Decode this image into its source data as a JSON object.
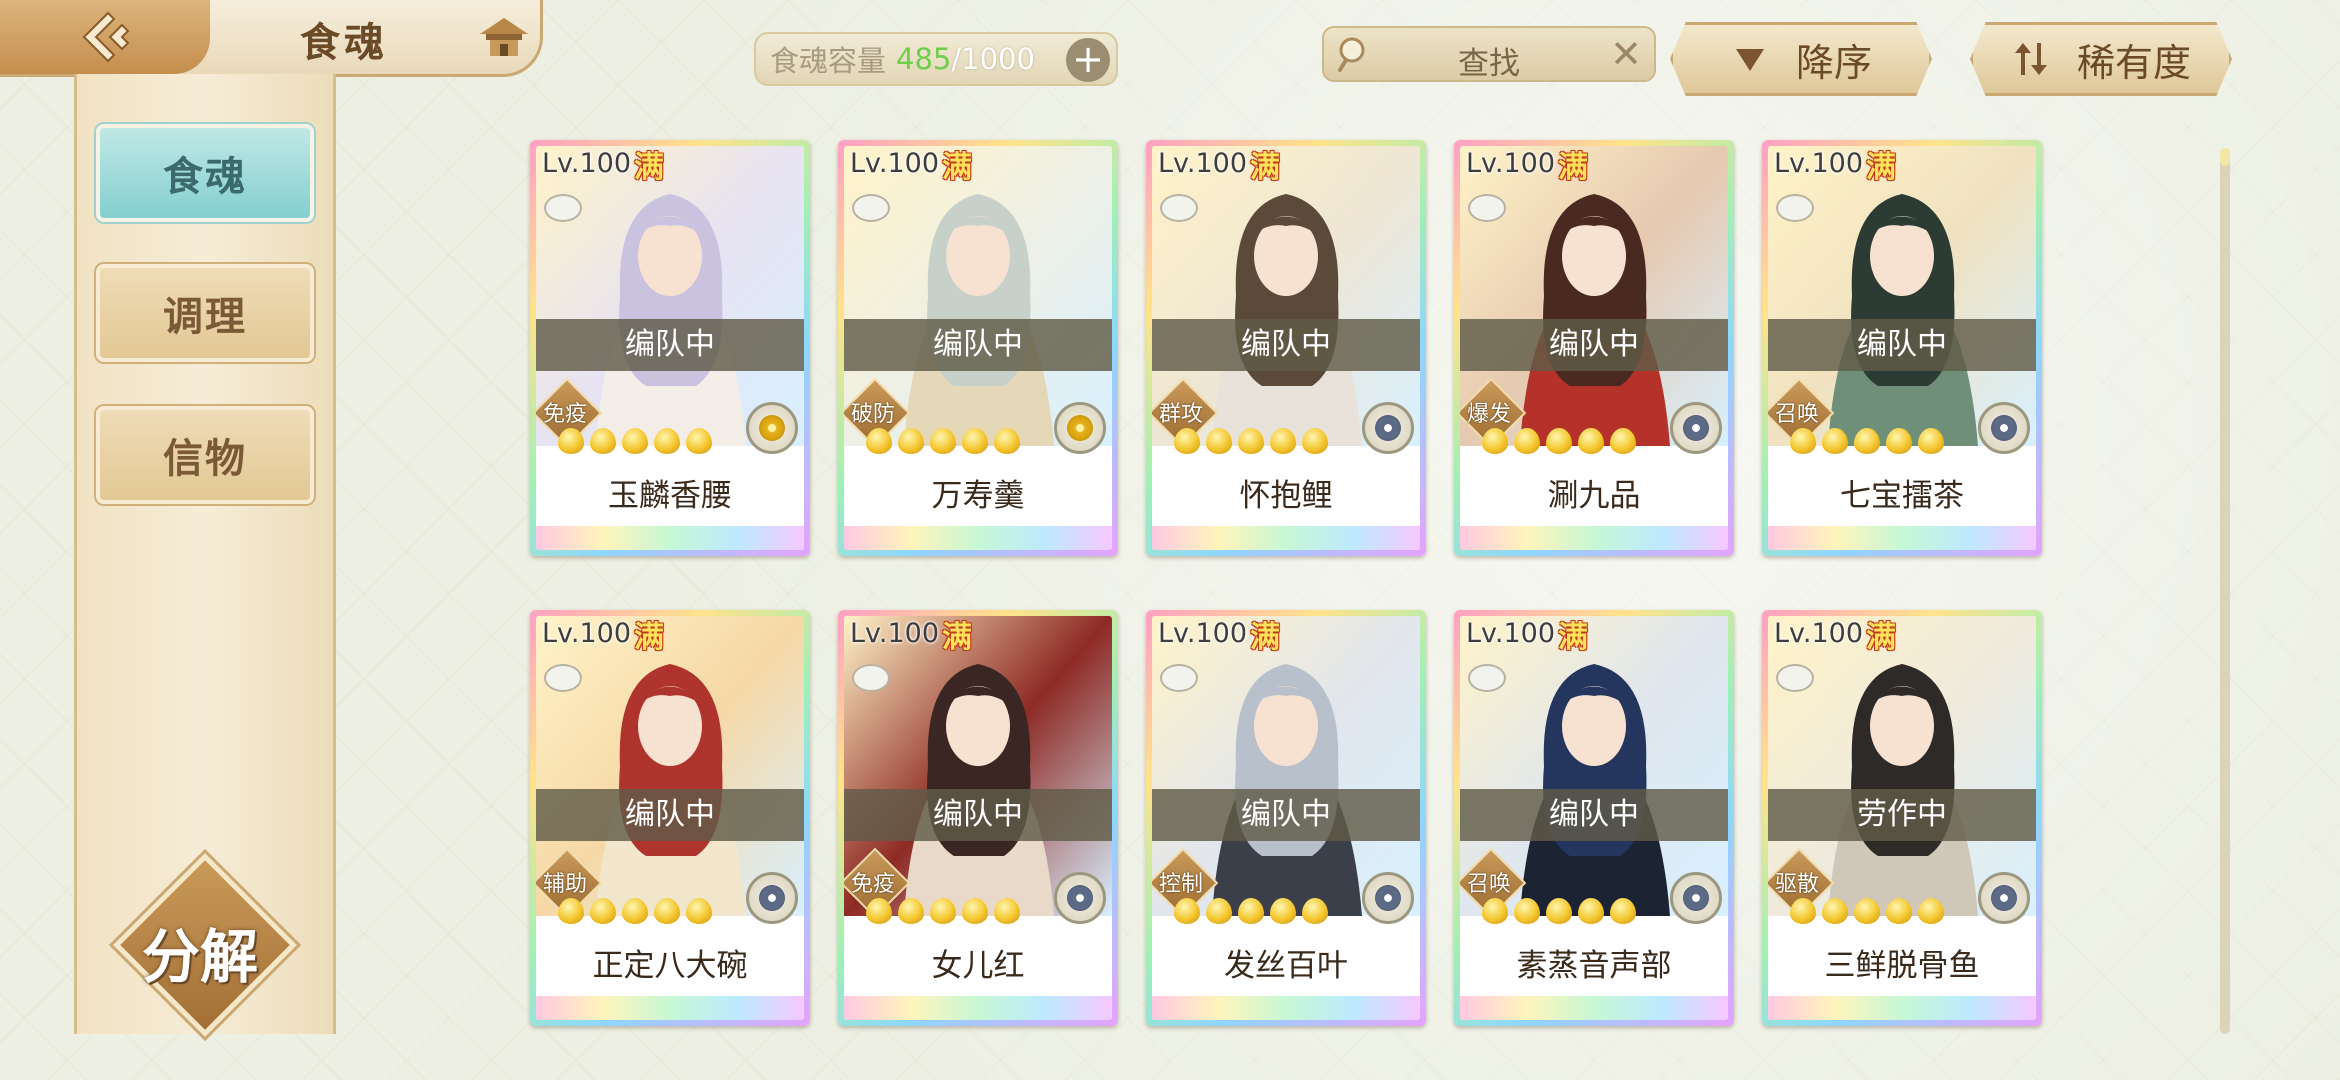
{
  "header": {
    "title": "食魂",
    "capacity_label": "食魂容量",
    "capacity_current": "485",
    "capacity_total": "/1000",
    "search_placeholder": "查找",
    "sort_order_label": "降序",
    "sort_by_label": "稀有度"
  },
  "sidebar": {
    "tabs": [
      {
        "label": "食魂",
        "active": true
      },
      {
        "label": "调理",
        "active": false
      },
      {
        "label": "信物",
        "active": false
      }
    ],
    "decompose_label": "分解"
  },
  "cards": [
    {
      "level": "Lv.100",
      "badge": "满",
      "status": "编队中",
      "role": "免疫",
      "stars": 5,
      "emblem": "gold",
      "name": "玉麟香腰",
      "palette": [
        "#e7e3f2",
        "#c9c3e0",
        "#f3efe8"
      ]
    },
    {
      "level": "Lv.100",
      "badge": "满",
      "status": "编队中",
      "role": "破防",
      "stars": 5,
      "emblem": "gold",
      "name": "万寿羹",
      "palette": [
        "#eef0e6",
        "#c7d1c9",
        "#e4d8b8"
      ]
    },
    {
      "level": "Lv.100",
      "badge": "满",
      "status": "编队中",
      "role": "群攻",
      "stars": 5,
      "emblem": "blue",
      "name": "怀抱鲤",
      "palette": [
        "#efe6d4",
        "#5b4a3a",
        "#e8e2da"
      ]
    },
    {
      "level": "Lv.100",
      "badge": "满",
      "status": "编队中",
      "role": "爆发",
      "stars": 5,
      "emblem": "blue",
      "name": "涮九品",
      "palette": [
        "#e6c9b0",
        "#4a2a20",
        "#b5322a"
      ]
    },
    {
      "level": "Lv.100",
      "badge": "满",
      "status": "编队中",
      "role": "召唤",
      "stars": 5,
      "emblem": "blue",
      "name": "七宝擂茶",
      "palette": [
        "#f0e2c0",
        "#2c3b33",
        "#6f8f78"
      ]
    },
    {
      "level": "Lv.100",
      "badge": "满",
      "status": "编队中",
      "role": "辅助",
      "stars": 5,
      "emblem": "blue",
      "name": "正定八大碗",
      "palette": [
        "#f6d8a6",
        "#b0342e",
        "#f2e7cc"
      ]
    },
    {
      "level": "Lv.100",
      "badge": "满",
      "status": "编队中",
      "role": "免疫",
      "stars": 5,
      "emblem": "blue",
      "name": "女儿红",
      "palette": [
        "#8e2a24",
        "#3a2622",
        "#e9d9c8"
      ]
    },
    {
      "level": "Lv.100",
      "badge": "满",
      "status": "编队中",
      "role": "控制",
      "stars": 5,
      "emblem": "blue",
      "name": "发丝百叶",
      "palette": [
        "#e2e6ec",
        "#b8c0cc",
        "#3a3f4a"
      ]
    },
    {
      "level": "Lv.100",
      "badge": "满",
      "status": "编队中",
      "role": "召唤",
      "stars": 5,
      "emblem": "blue",
      "name": "素蒸音声部",
      "palette": [
        "#dfe6ee",
        "#24355e",
        "#1c2333"
      ]
    },
    {
      "level": "Lv.100",
      "badge": "满",
      "status": "劳作中",
      "role": "驱散",
      "stars": 5,
      "emblem": "blue",
      "name": "三鲜脱骨鱼",
      "palette": [
        "#efeadc",
        "#2d2a28",
        "#cfc7b8"
      ]
    }
  ]
}
